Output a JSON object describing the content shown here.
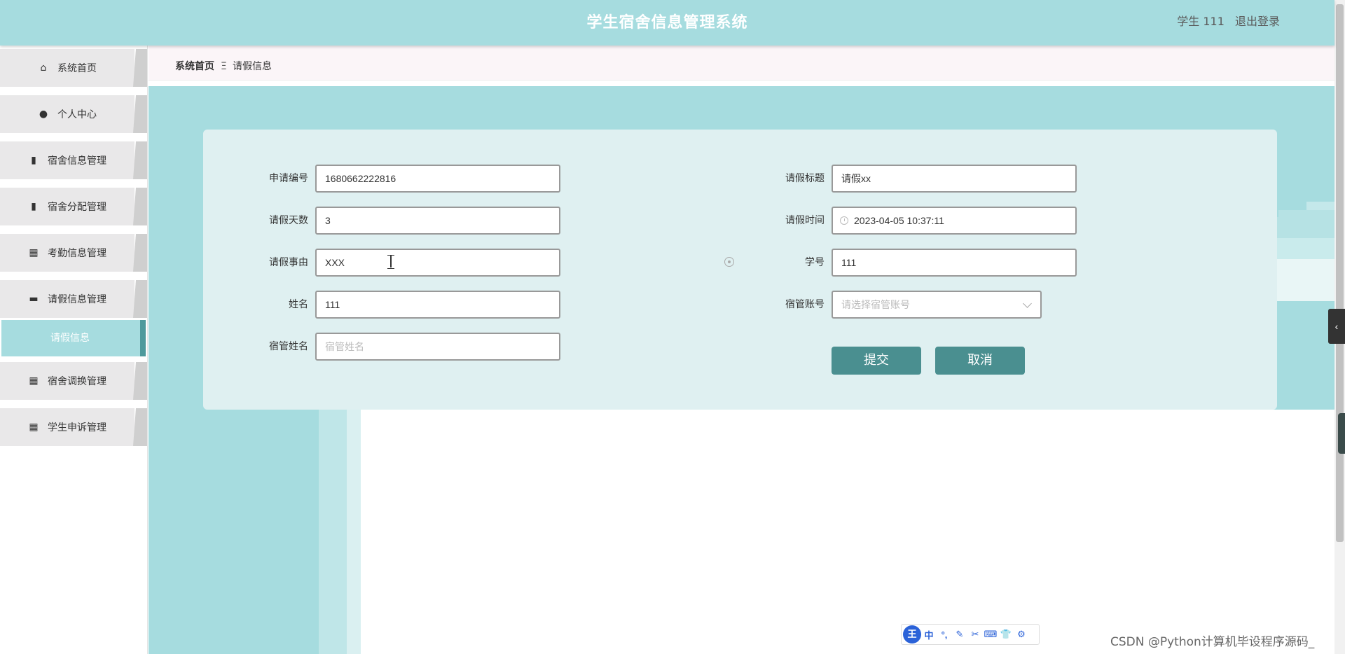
{
  "header": {
    "title": "学生宿舍信息管理系统",
    "user_label": "学生 111",
    "logout_label": "退出登录"
  },
  "sidebar": {
    "items": [
      {
        "label": "系统首页",
        "icon": "home-icon"
      },
      {
        "label": "个人中心",
        "icon": "user-icon"
      },
      {
        "label": "宿舍信息管理",
        "icon": "clipboard-icon"
      },
      {
        "label": "宿舍分配管理",
        "icon": "clipboard-x-icon"
      },
      {
        "label": "考勤信息管理",
        "icon": "grid-icon"
      },
      {
        "label": "请假信息管理",
        "icon": "ticket-icon"
      },
      {
        "label": "宿舍调换管理",
        "icon": "grid-icon"
      },
      {
        "label": "学生申诉管理",
        "icon": "grid-icon"
      }
    ],
    "active_submenu": "请假信息"
  },
  "breadcrumb": {
    "home": "系统首页",
    "separator": "Ξ",
    "current": "请假信息"
  },
  "form": {
    "application_no": {
      "label": "申请编号",
      "value": "1680662222816"
    },
    "leave_title": {
      "label": "请假标题",
      "value": "请假xx"
    },
    "leave_days": {
      "label": "请假天数",
      "value": "3"
    },
    "leave_time": {
      "label": "请假时间",
      "value": "2023-04-05 10:37:11"
    },
    "leave_reason": {
      "label": "请假事由",
      "value": "XXX"
    },
    "student_id": {
      "label": "学号",
      "value": "111"
    },
    "name": {
      "label": "姓名",
      "value": "111"
    },
    "manager_account": {
      "label": "宿管账号",
      "placeholder": "请选择宿管账号"
    },
    "manager_name": {
      "label": "宿管姓名",
      "placeholder": "宿管姓名"
    },
    "submit_label": "提交",
    "cancel_label": "取消"
  },
  "ime_toolbar": {
    "logo": "王",
    "mode": "中",
    "items": [
      "°,",
      "✎",
      "✂",
      "⌨",
      "👕",
      "⚙"
    ]
  },
  "watermark": "CSDN @Python计算机毕设程序源码_",
  "colors": {
    "header_bg": "#a6dcdf",
    "accent": "#4a8f90",
    "card_bg": "#dff0f1"
  }
}
